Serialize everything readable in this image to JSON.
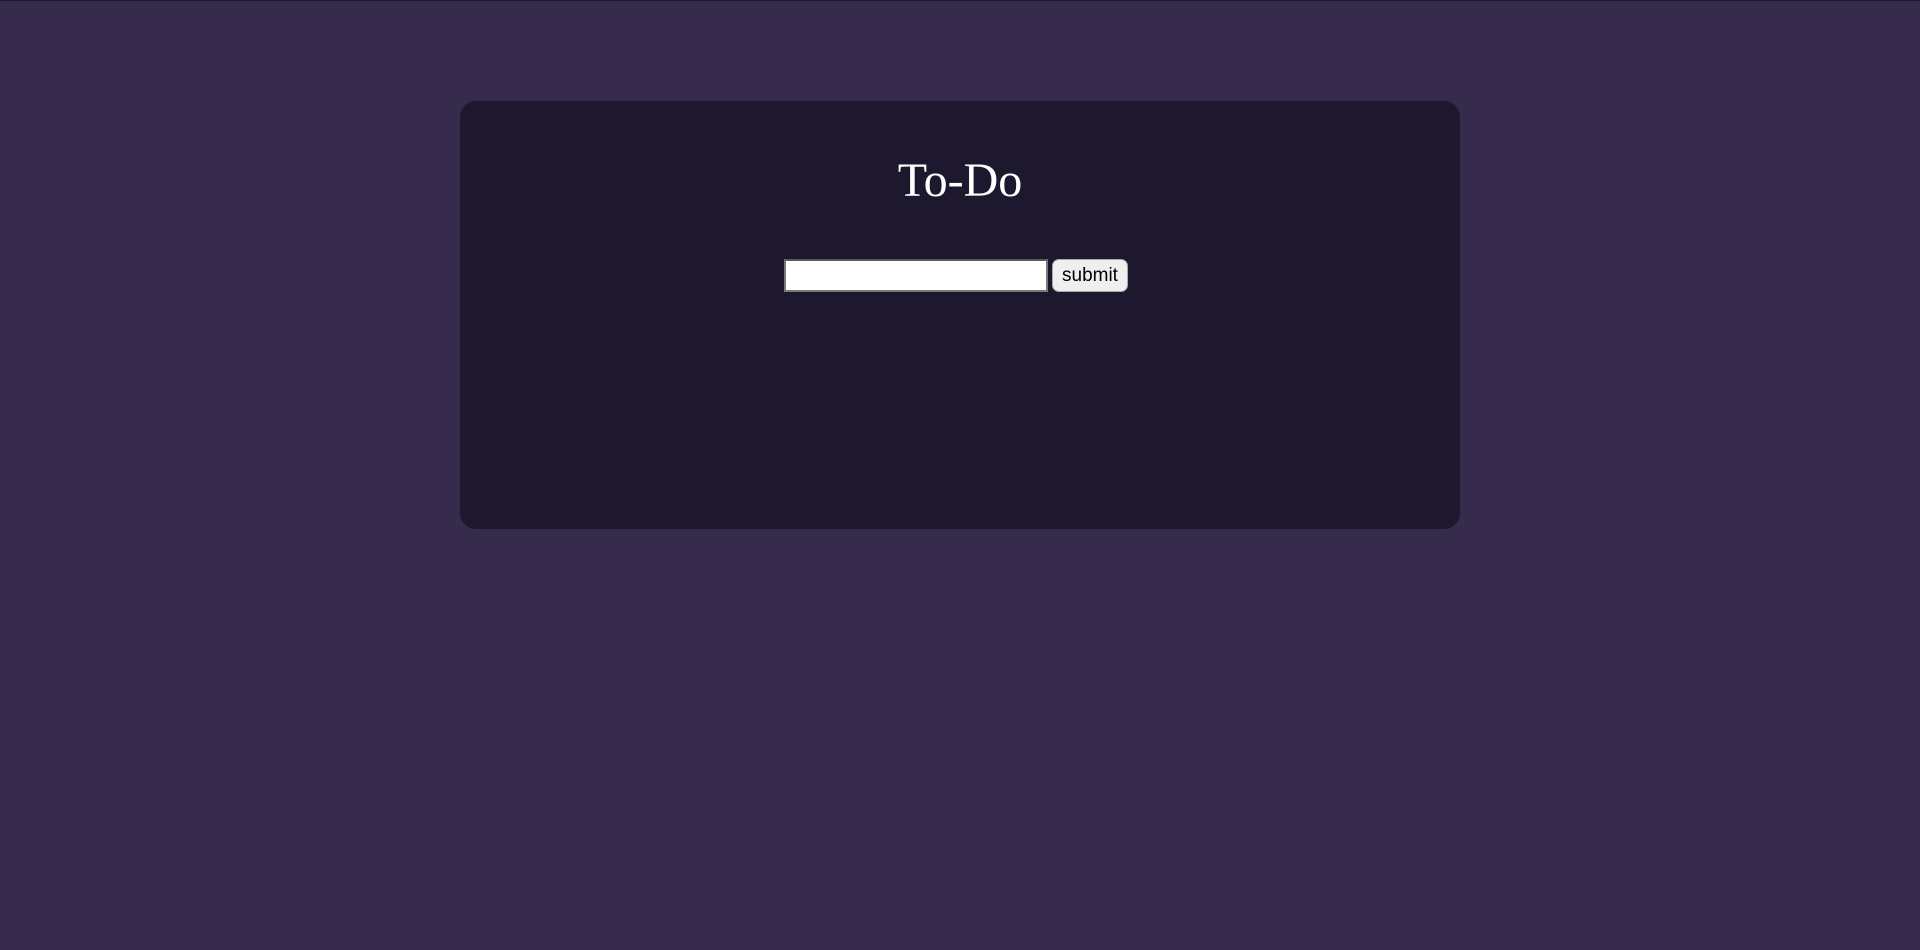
{
  "page": {
    "title": "To-Do"
  },
  "form": {
    "input_value": "",
    "input_placeholder": "",
    "submit_label": "submit"
  },
  "colors": {
    "background": "#372b4d",
    "card": "#1d182e",
    "title_text": "#ffffff",
    "button_bg": "#efefef"
  }
}
